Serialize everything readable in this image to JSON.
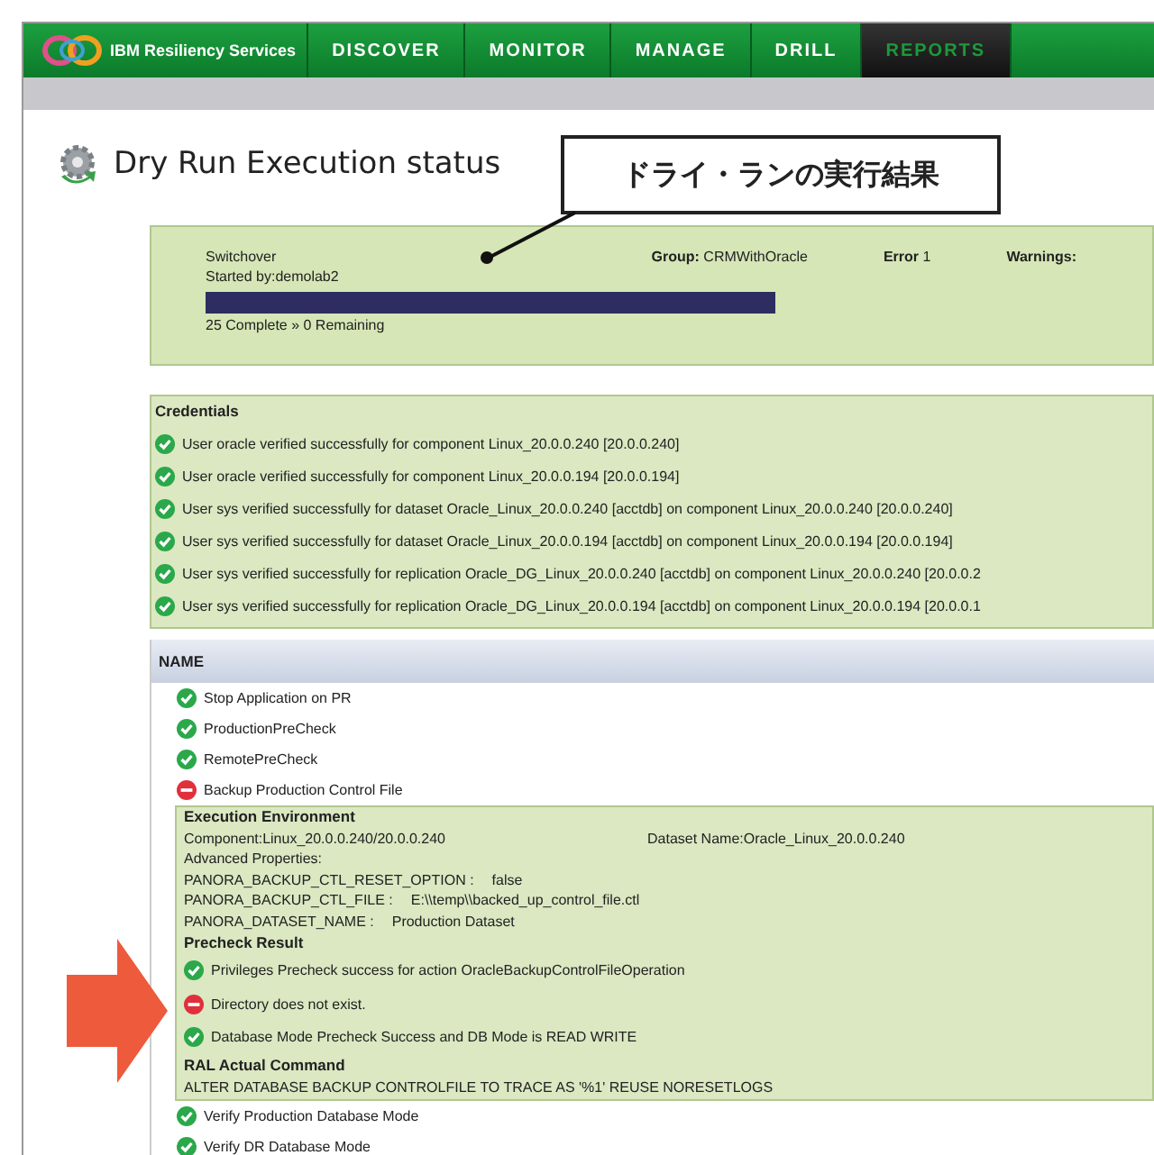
{
  "nav": {
    "brand": "IBM Resiliency Services",
    "tabs": [
      {
        "label": "DISCOVER",
        "selected": false
      },
      {
        "label": "MONITOR",
        "selected": false
      },
      {
        "label": "MANAGE",
        "selected": false
      },
      {
        "label": "DRILL",
        "selected": false
      },
      {
        "label": "REPORTS",
        "selected": true
      }
    ]
  },
  "page": {
    "title": "Dry Run Execution status",
    "callout": "ドライ・ランの実行結果"
  },
  "summary": {
    "operation": "Switchover",
    "started_by": "Started by:demolab2",
    "group_label": "Group:",
    "group_value": "CRMWithOracle",
    "error_label": "Error",
    "error_value": "1",
    "warnings_label": "Warnings:",
    "level": 1,
    "progress_text": "25 Complete » 0 Remaining"
  },
  "credentials": {
    "title": "Credentials",
    "items": [
      {
        "text": "User oracle verified successfully for component Linux_20.0.0.240 [20.0.0.240]",
        "failed": false
      },
      {
        "text": "User oracle verified successfully for component Linux_20.0.0.194 [20.0.0.194]",
        "failed": false
      },
      {
        "text": "User sys verified successfully for dataset Oracle_Linux_20.0.0.240 [acctdb] on component Linux_20.0.0.240 [20.0.0.240]",
        "failed": false
      },
      {
        "text": "User sys verified successfully for dataset Oracle_Linux_20.0.0.194 [acctdb] on component Linux_20.0.0.194 [20.0.0.194]",
        "failed": false
      },
      {
        "text": "User sys verified successfully for replication Oracle_DG_Linux_20.0.0.240 [acctdb] on component Linux_20.0.0.240 [20.0.0.2",
        "failed": false
      },
      {
        "text": "User sys verified successfully for replication Oracle_DG_Linux_20.0.0.194 [acctdb] on component Linux_20.0.0.194 [20.0.0.1",
        "failed": false
      }
    ]
  },
  "table": {
    "header": "NAME",
    "steps": [
      {
        "text": "Stop Application on PR",
        "failed": false
      },
      {
        "text": "ProductionPreCheck",
        "failed": false
      },
      {
        "text": "RemotePreCheck",
        "failed": false
      },
      {
        "text": "Backup Production Control File",
        "failed": true
      }
    ],
    "detail": {
      "env_title": "Execution Environment",
      "component": "Component:Linux_20.0.0.240/20.0.0.240",
      "dataset": "Dataset Name:Oracle_Linux_20.0.0.240",
      "advanced": "Advanced Properties:",
      "properties": [
        {
          "key": "PANORA_BACKUP_CTL_RESET_OPTION :",
          "value": "false"
        },
        {
          "key": "PANORA_BACKUP_CTL_FILE :",
          "value": "E:\\\\temp\\\\backed_up_control_file.ctl"
        },
        {
          "key": "PANORA_DATASET_NAME :",
          "value": "Production Dataset"
        }
      ],
      "precheck_title": "Precheck Result",
      "prechecks": [
        {
          "text": "Privileges Precheck success for action OracleBackupControlFileOperation",
          "failed": false
        },
        {
          "text": "Directory does not exist.",
          "failed": true
        },
        {
          "text": "Database Mode Precheck Success and DB Mode is READ WRITE",
          "failed": false
        }
      ],
      "command_title": "RAL Actual Command",
      "command": "ALTER DATABASE BACKUP CONTROLFILE TO TRACE AS '%1' REUSE NORESETLOGS"
    },
    "steps_after": [
      {
        "text": "Verify Production Database Mode",
        "failed": false
      },
      {
        "text": "Verify DR Database Mode",
        "failed": false
      }
    ]
  }
}
